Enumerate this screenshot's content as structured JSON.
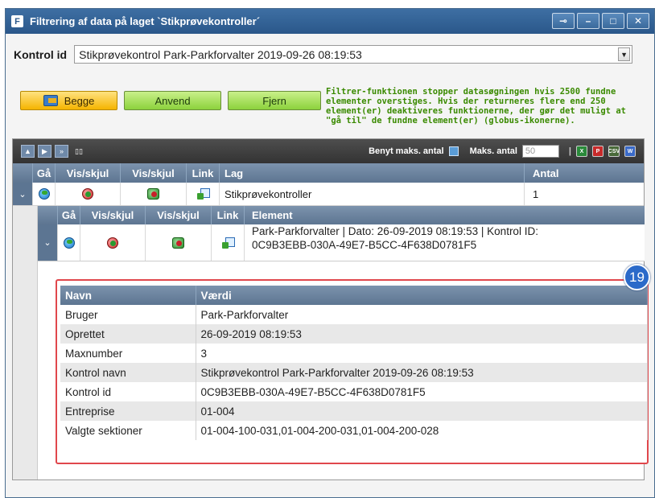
{
  "window": {
    "logo_letter": "F",
    "title": "Filtrering af data på laget `Stikprøvekontroller´",
    "buttons": [
      "pin",
      "minimize",
      "maximize",
      "close"
    ]
  },
  "kontrol": {
    "label": "Kontrol id",
    "selected": "Stikprøvekontrol Park-Parkforvalter 2019-09-26 08:19:53"
  },
  "actions": {
    "begge": "Begge",
    "anvend": "Anvend",
    "fjern": "Fjern"
  },
  "info": "Filtrer-funktionen stopper datasøgningen hvis 2500 fundne elementer overstiges. Hvis der returneres flere end 250 element(er) deaktiveres funktionerne, der gør det muligt at \"gå til\" de fundne element(er) (globus-ikonerne).",
  "toolbar": {
    "benyt_label": "Benyt maks. antal",
    "maks_label": "Maks. antal",
    "maks_placeholder": "50",
    "export_icons": [
      "excel-icon",
      "pdf-icon",
      "csv-icon",
      "word-icon"
    ]
  },
  "layer_table": {
    "headers": [
      "Gå",
      "Vis/skjul",
      "Vis/skjul",
      "Link",
      "Lag",
      "Antal"
    ],
    "row": {
      "lag": "Stikprøvekontroller",
      "antal": "1"
    }
  },
  "element_table": {
    "headers": [
      "Gå",
      "Vis/skjul",
      "Vis/skjul",
      "Link",
      "Element"
    ],
    "row": {
      "element_line1": "Park-Parkforvalter | Dato: 26-09-2019 08:19:53 | Kontrol ID:",
      "element_line2": "0C9B3EBB-030A-49E7-B5CC-4F638D0781F5"
    }
  },
  "detail": {
    "headers": [
      "Navn",
      "Værdi"
    ],
    "rows": [
      [
        "Bruger",
        "Park-Parkforvalter"
      ],
      [
        "Oprettet",
        "26-09-2019 08:19:53"
      ],
      [
        "Maxnumber",
        "3"
      ],
      [
        "Kontrol navn",
        "Stikprøvekontrol Park-Parkforvalter 2019-09-26 08:19:53"
      ],
      [
        "Kontrol id",
        "0C9B3EBB-030A-49E7-B5CC-4F638D0781F5"
      ],
      [
        "Entreprise",
        "01-004"
      ],
      [
        "Valgte sektioner",
        "01-004-100-031,01-004-200-031,01-004-200-028"
      ]
    ]
  },
  "badge": "19"
}
